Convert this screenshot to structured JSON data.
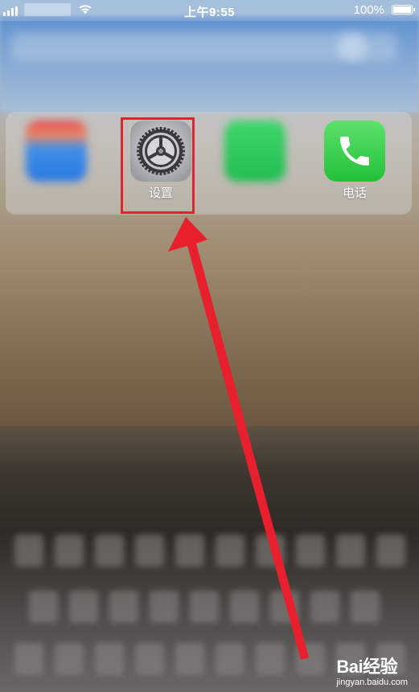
{
  "status_bar": {
    "time": "上午9:55",
    "battery_percent": "100%",
    "signal_bars": 4,
    "battery_level": 1.0
  },
  "dock": {
    "apps": [
      {
        "label": "",
        "icon": "blurred-app-icon"
      },
      {
        "label": "设置",
        "icon": "settings-gear-icon"
      },
      {
        "label": "",
        "icon": "blurred-messages-icon"
      },
      {
        "label": "电话",
        "icon": "phone-icon"
      }
    ]
  },
  "annotation": {
    "color": "#e8202e",
    "target": "设置"
  },
  "watermark": {
    "brand": "Bai经验",
    "site": "jingyan.baidu.com"
  }
}
